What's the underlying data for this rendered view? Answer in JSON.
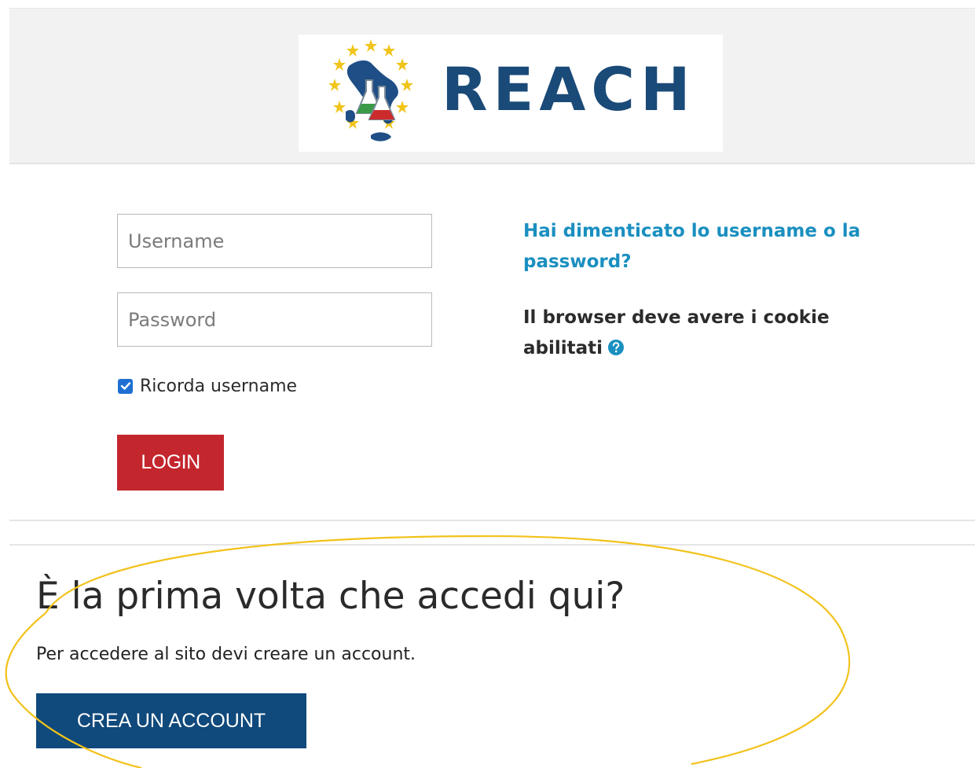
{
  "brand": {
    "name": "REACH",
    "colors": {
      "text": "#1a4a78",
      "map": "#1f4e86",
      "stars": "#f0c419",
      "flag_green": "#3a9a47",
      "flag_red": "#cc2b2b"
    }
  },
  "login": {
    "username_placeholder": "Username",
    "password_placeholder": "Password",
    "remember": {
      "label": "Ricorda username",
      "checked": true
    },
    "submit_label": "LOGIN",
    "submit_color": "#c4262e"
  },
  "help": {
    "forgot_link": "Hai dimenticato lo username o la password?",
    "cookie_notice": "Il browser deve avere i cookie abilitati",
    "cookie_help_icon": "question-circle-icon"
  },
  "signup": {
    "title": "È la prima volta che accedi qui?",
    "description": "Per accedere al sito devi creare un account.",
    "button_label": "CREA UN ACCOUNT",
    "button_color": "#10497b"
  },
  "annotation": {
    "shape": "ellipse",
    "color": "#f2c21b"
  }
}
